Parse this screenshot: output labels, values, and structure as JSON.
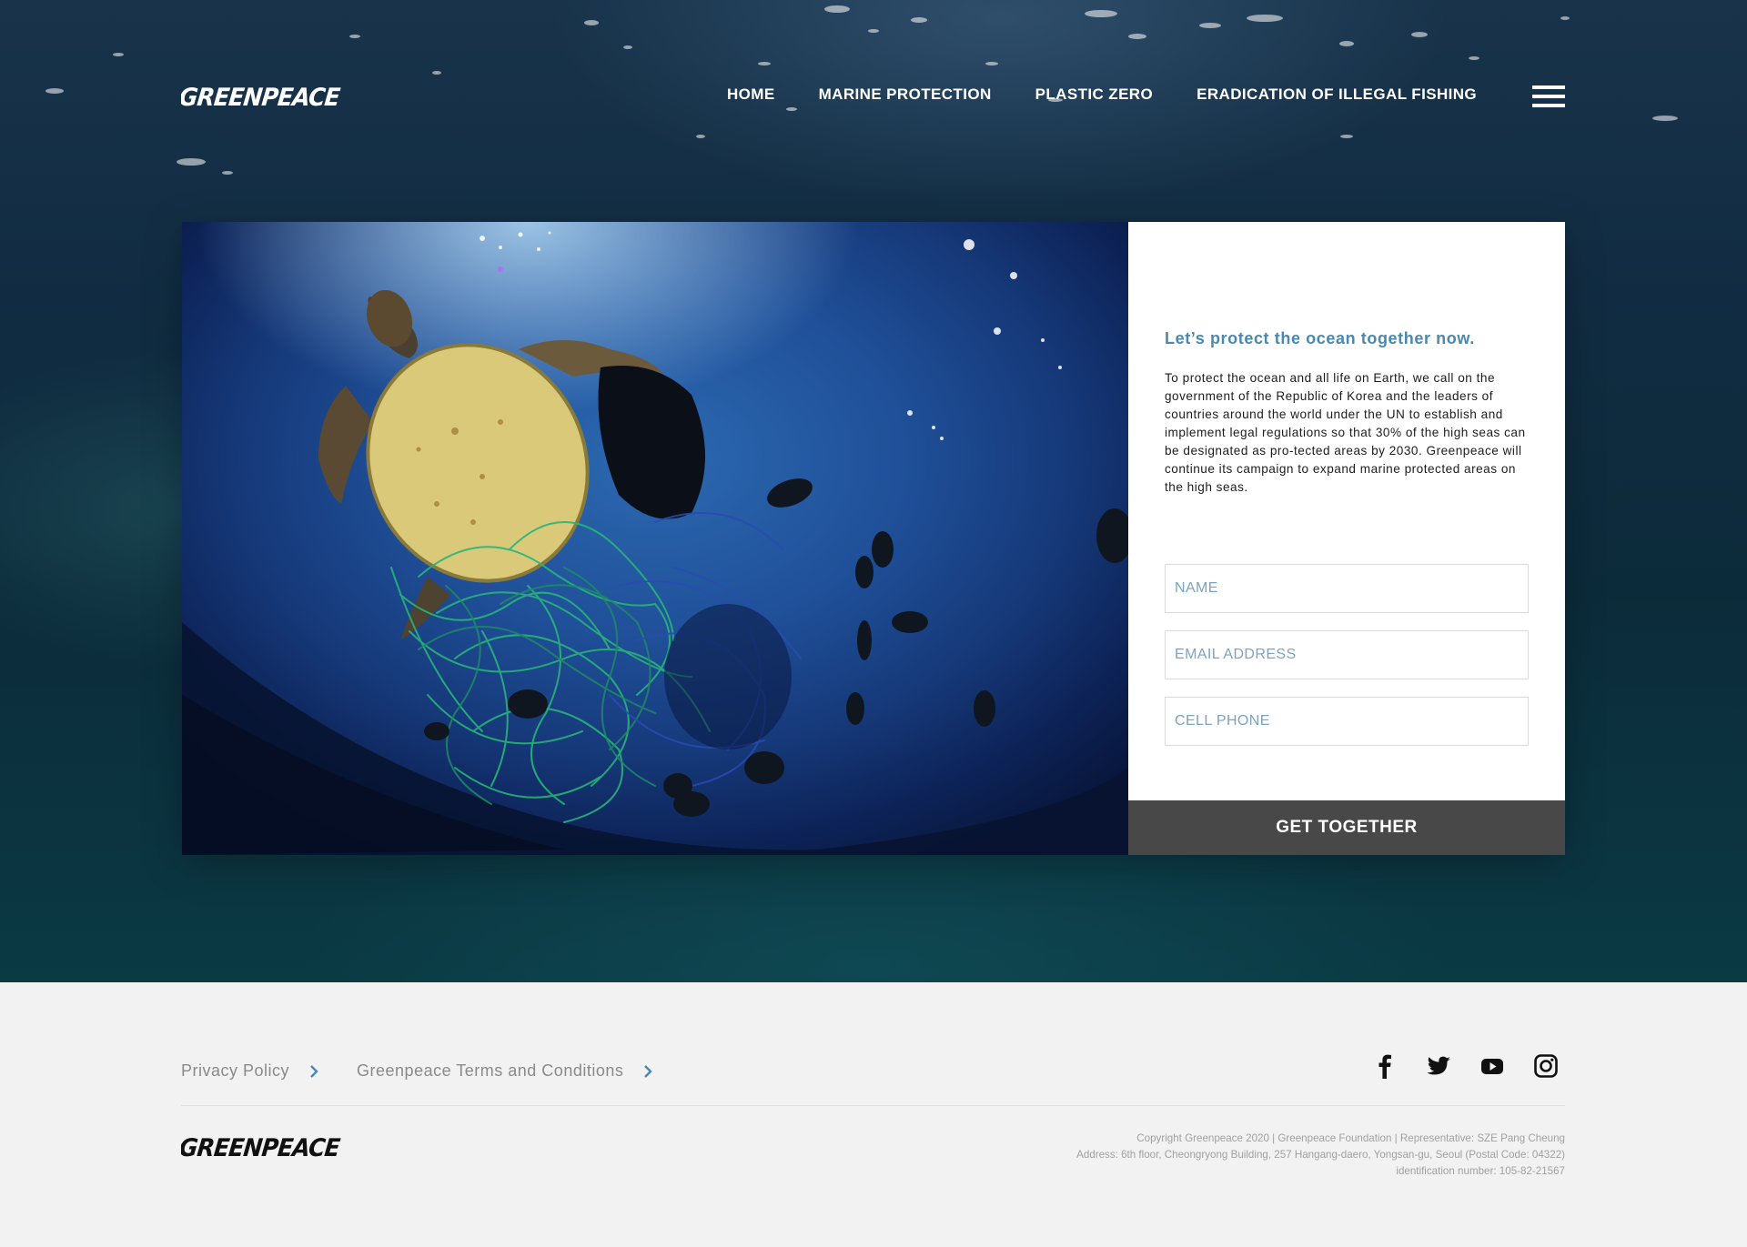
{
  "brand": {
    "name": "GREENPEACE"
  },
  "nav": {
    "items": [
      {
        "label": "HOME"
      },
      {
        "label": "MARINE PROTECTION"
      },
      {
        "label": "PLASTIC ZERO"
      },
      {
        "label": "ERADICATION OF ILLEGAL FISHING"
      }
    ],
    "menu_icon": "hamburger-menu-icon"
  },
  "form": {
    "heading": "Let’s protect the ocean together now.",
    "body": "To protect the ocean and all life on Earth, we call on the government of the Republic of Korea and the leaders of countries around the world under the UN to establish and implement legal regulations so that 30% of the high seas can be designated as pro-tected areas by 2030. Greenpeace will continue its campaign to expand marine protected areas on the high seas.",
    "fields": {
      "name_placeholder": "NAME",
      "email_placeholder": "EMAIL ADDRESS",
      "phone_placeholder": "CELL PHONE"
    },
    "submit_label": "GET TOGETHER"
  },
  "footer": {
    "links": [
      {
        "label": "Privacy Policy"
      },
      {
        "label": "Greenpeace Terms and Conditions"
      }
    ],
    "social": [
      "facebook-icon",
      "twitter-icon",
      "youtube-icon",
      "instagram-icon"
    ],
    "legal": [
      "Copyright Greenpeace 2020 | Greenpeace Foundation | Representative: SZE Pang Cheung",
      "Address: 6th floor, Cheongryong Building, 257 Hangang-daero, Yongsan-gu, Seoul (Postal Code: 04322)",
      "identification number: 105-82-21567"
    ]
  },
  "colors": {
    "accent_blue": "#4a88b0",
    "button_dark": "#484848",
    "footer_bg": "#f2f2f2"
  }
}
